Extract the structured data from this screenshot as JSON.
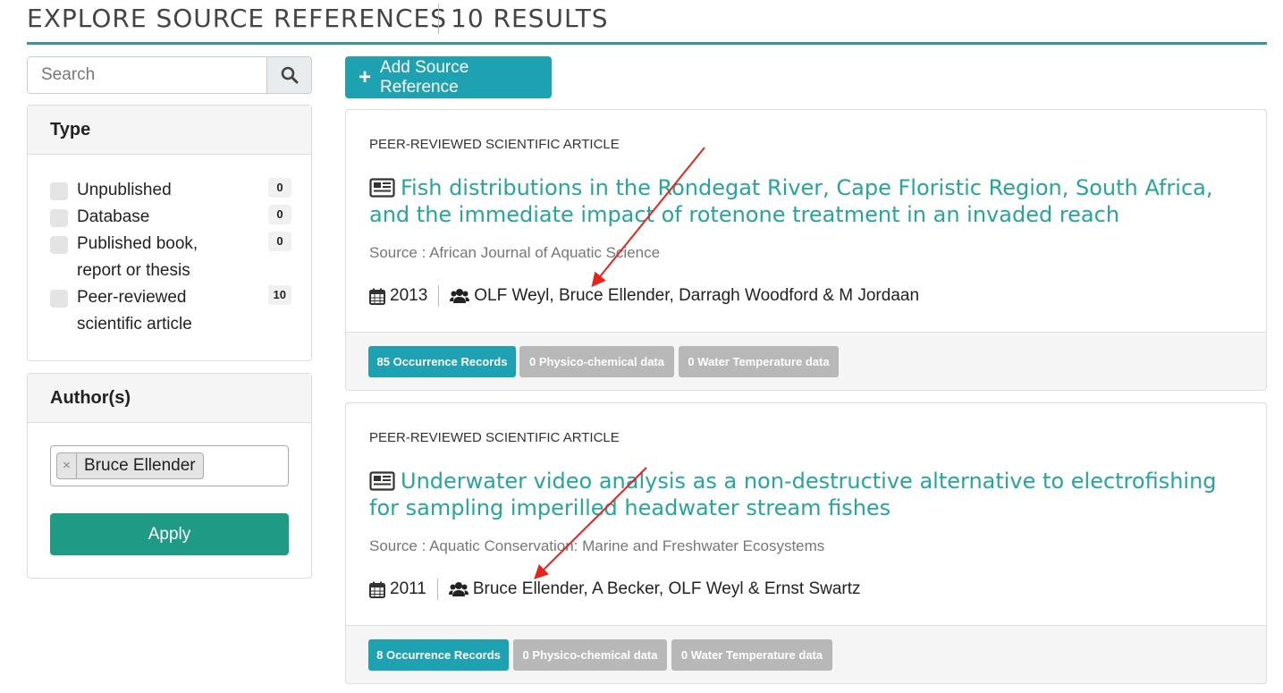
{
  "header": {
    "title": "EXPLORE SOURCE REFERENCES",
    "results": "10 RESULTS"
  },
  "search": {
    "placeholder": "Search",
    "icon": "search-icon"
  },
  "type_filter": {
    "heading": "Type",
    "items": [
      {
        "label": "Unpublished",
        "count": "0"
      },
      {
        "label": "Database",
        "count": "0"
      },
      {
        "label": "Published book, report or thesis",
        "count": "0"
      },
      {
        "label": "Peer-reviewed scientific article",
        "count": "10"
      }
    ]
  },
  "author_filter": {
    "heading": "Author(s)",
    "selected": "Bruce Ellender",
    "remove_symbol": "×",
    "apply_label": "Apply"
  },
  "toolbar": {
    "add_label": "Add Source Reference"
  },
  "colors": {
    "accent_teal": "#26a69a",
    "button_teal": "#1ea2b2",
    "apply_green": "#1f9a84",
    "annotation_red": "#e8231c"
  },
  "results": [
    {
      "kind": "PEER-REVIEWED SCIENTIFIC ARTICLE",
      "title": "Fish distributions in the Rondegat River, Cape Floristic Region, South Africa, and the immediate impact of rotenone treatment in an invaded reach",
      "source": "Source : African Journal of Aquatic Science",
      "year": "2013",
      "authors": "OLF Weyl, Bruce Ellender, Darragh Woodford & M Jordaan",
      "badges": [
        "85 Occurrence Records",
        "0 Physico-chemical data",
        "0 Water Temperature data"
      ]
    },
    {
      "kind": "PEER-REVIEWED SCIENTIFIC ARTICLE",
      "title": "Underwater video analysis as a non-destructive alternative to electrofishing for sampling imperilled headwater stream fishes",
      "source": "Source : Aquatic Conservation: Marine and Freshwater Ecosystems",
      "year": "2011",
      "authors": "Bruce Ellender, A Becker, OLF Weyl & Ernst Swartz",
      "badges": [
        "8 Occurrence Records",
        "0 Physico-chemical data",
        "0 Water Temperature data"
      ]
    }
  ]
}
